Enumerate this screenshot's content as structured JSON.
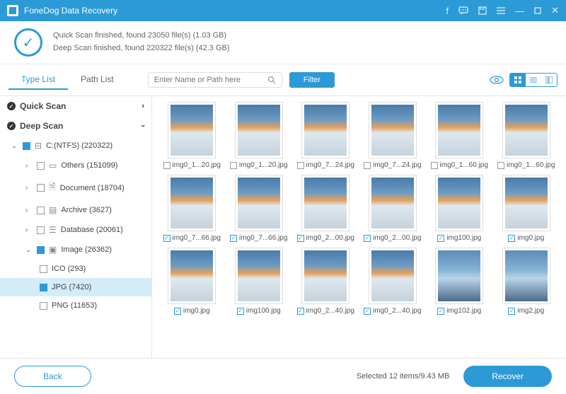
{
  "titlebar": {
    "app_name": "FoneDog Data Recovery"
  },
  "status": {
    "quick": "Quick Scan finished, found 23050 file(s) (1.03 GB)",
    "deep": "Deep Scan finished, found 220322 file(s) (42.3 GB)"
  },
  "tabs": {
    "type_list": "Type List",
    "path_list": "Path List"
  },
  "search": {
    "placeholder": "Enter Name or Path here"
  },
  "filter_label": "Filter",
  "sidebar": {
    "quick_scan": "Quick Scan",
    "deep_scan": "Deep Scan",
    "drive": "C:(NTFS) (220322)",
    "others": "Others (151099)",
    "document": "Document (18704)",
    "archive": "Archive (3627)",
    "database": "Database (20061)",
    "image": "Image (26362)",
    "ico": "ICO (293)",
    "jpg": "JPG (7420)",
    "png": "PNG (11653)"
  },
  "thumbs": [
    {
      "name": "img0_1...20.jpg",
      "checked": false
    },
    {
      "name": "img0_1...20.jpg",
      "checked": false
    },
    {
      "name": "img0_7...24.jpg",
      "checked": false
    },
    {
      "name": "img0_7...24.jpg",
      "checked": false
    },
    {
      "name": "img0_1...60.jpg",
      "checked": false
    },
    {
      "name": "img0_1...60.jpg",
      "checked": false
    },
    {
      "name": "img0_7...66.jpg",
      "checked": true
    },
    {
      "name": "img0_7...66.jpg",
      "checked": true
    },
    {
      "name": "img0_2...00.jpg",
      "checked": true
    },
    {
      "name": "img0_2...00.jpg",
      "checked": true
    },
    {
      "name": "img100.jpg",
      "checked": true
    },
    {
      "name": "img0.jpg",
      "checked": true
    },
    {
      "name": "img0.jpg",
      "checked": true
    },
    {
      "name": "img100.jpg",
      "checked": true
    },
    {
      "name": "img0_2...40.jpg",
      "checked": true
    },
    {
      "name": "img0_2...40.jpg",
      "checked": true
    },
    {
      "name": "img102.jpg",
      "checked": true,
      "alt": true
    },
    {
      "name": "img2.jpg",
      "checked": true,
      "alt": true
    }
  ],
  "footer": {
    "back": "Back",
    "selected": "Selected 12 items/9.43 MB",
    "recover": "Recover"
  }
}
